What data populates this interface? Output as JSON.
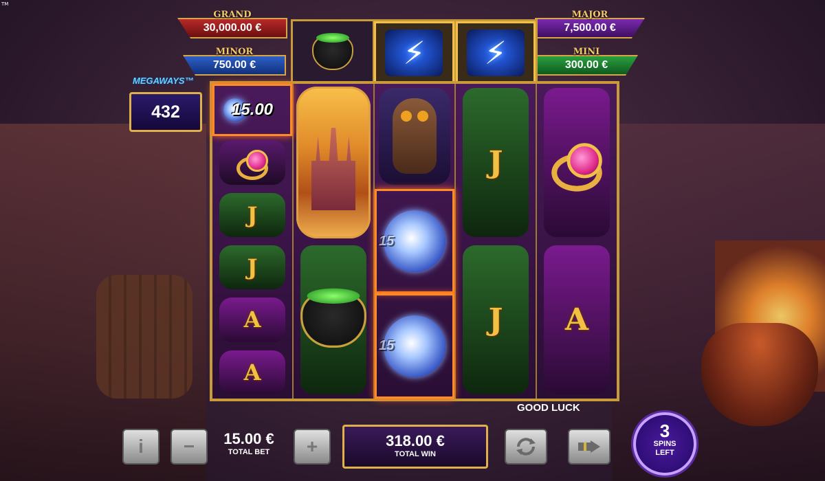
{
  "copyright_mark": "TM",
  "jackpots": {
    "grand": {
      "title": "GRAND",
      "value": "30,000.00 €"
    },
    "minor": {
      "title": "MINOR",
      "value": "750.00 €"
    },
    "major": {
      "title": "MAJOR",
      "value": "7,500.00 €"
    },
    "mini": {
      "title": "MINI",
      "value": "300.00 €"
    }
  },
  "megaways": {
    "label": "MEGAWAYS™",
    "value": "432"
  },
  "top_row": [
    "cauldron",
    "lightning-bolt",
    "lightning-bolt"
  ],
  "reels": [
    [
      "orb:15.00",
      "ring",
      "J",
      "J",
      "A",
      "A"
    ],
    [
      "castle",
      "cauldron"
    ],
    [
      "owl",
      "orb:15.00",
      "orb:15.00"
    ],
    [
      "J",
      "J"
    ],
    [
      "ring",
      "A"
    ]
  ],
  "orb_value": "15.00",
  "orb_value_partial": "15",
  "letters": {
    "j": "J",
    "a": "A"
  },
  "status_text": "GOOD LUCK",
  "bet": {
    "value": "15.00 €",
    "label": "TOTAL BET"
  },
  "win": {
    "value": "318.00 €",
    "label": "TOTAL WIN"
  },
  "buttons": {
    "info": "i",
    "minus": "−",
    "plus": "+"
  },
  "spins_left": {
    "count": "3",
    "label_line1": "SPINS",
    "label_line2": "LEFT"
  },
  "colors": {
    "gold": "#c89a3a",
    "grand": "#b82a2a",
    "minor": "#2c60c8",
    "major": "#7a2ab0",
    "mini": "#2aa040"
  }
}
